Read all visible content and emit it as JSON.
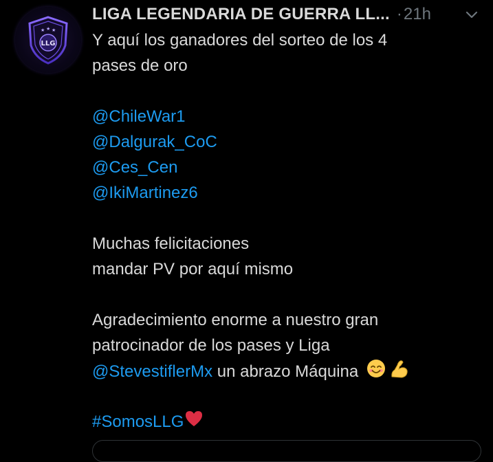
{
  "tweet": {
    "author_name": "LIGA LEGENDARIA DE GUERRA LL...",
    "separator": "·",
    "time": "21h",
    "lines": {
      "l1": "Y aquí los ganadores del sorteo de los 4",
      "l2": "pases de oro",
      "m1": "@ChileWar1",
      "m2": "@Dalgurak_CoC",
      "m3": "@Ces_Cen",
      "m4": "@IkiMartinez6",
      "l3": "Muchas felicitaciones",
      "l4": "mandar PV por aquí mismo",
      "l5": "Agradecimiento enorme a nuestro gran",
      "l6": "patrocinador de los pases y Liga",
      "m5": "@StevestiflerMx",
      "l7": " un abrazo Máquina  ",
      "hashtag": "#SomosLLG"
    },
    "emojis": [
      "smiling-face-icon",
      "flexed-biceps-icon",
      "red-heart-icon"
    ]
  },
  "avatar": {
    "logo_text": "LLG",
    "icon": "shield-logo-icon"
  },
  "colors": {
    "background": "#000000",
    "text": "#d9d9d9",
    "secondary": "#6e767d",
    "link": "#1d9bf0",
    "accent_purple": "#7b5cff"
  }
}
